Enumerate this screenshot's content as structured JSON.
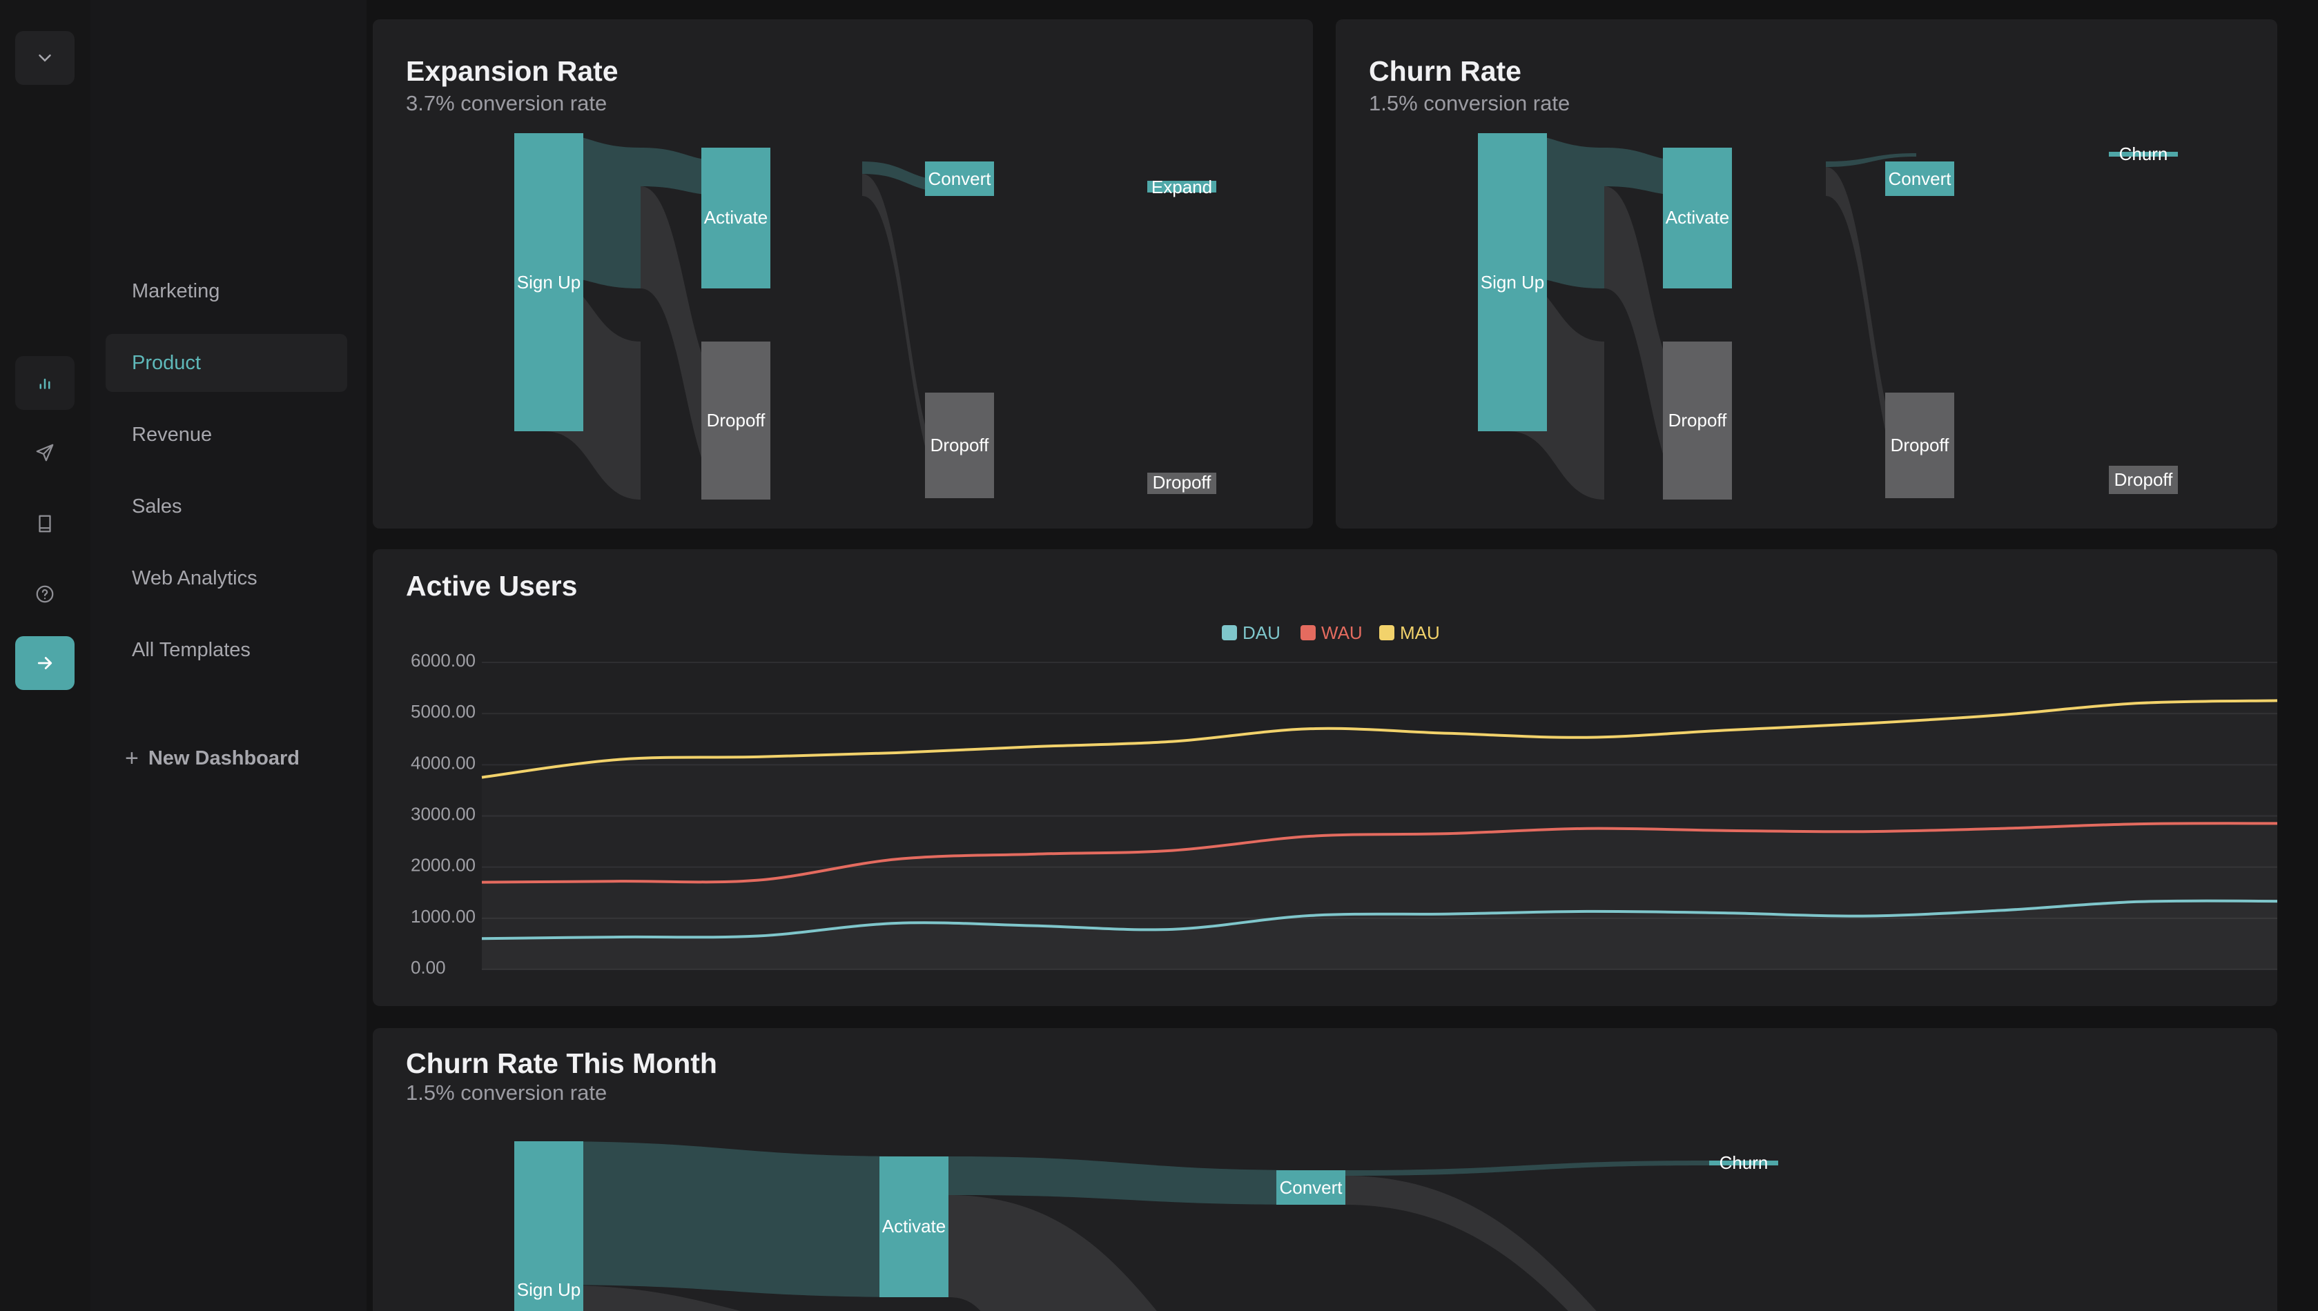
{
  "sidebar": {
    "items": [
      {
        "label": "Marketing"
      },
      {
        "label": "Product",
        "active": true
      },
      {
        "label": "Revenue"
      },
      {
        "label": "Sales"
      },
      {
        "label": "Web Analytics"
      },
      {
        "label": "All Templates"
      }
    ],
    "new_dashboard": "New Dashboard",
    "rail_icons": [
      "chevron-down-icon",
      "bar-chart-icon",
      "send-icon",
      "book-icon",
      "help-circle-icon",
      "arrow-right-icon"
    ]
  },
  "colors": {
    "accent": "#4fa7a8",
    "dropoff": "#606062",
    "dau": "#7fc6cb",
    "wau": "#e46b5f",
    "mau": "#f2d26b"
  },
  "cards": {
    "expansion": {
      "title": "Expansion Rate",
      "subtitle": "3.7% conversion rate",
      "nodes": {
        "signup": "Sign Up",
        "activate": "Activate",
        "dropoff1": "Dropoff",
        "convert": "Convert",
        "dropoff2": "Dropoff",
        "final": "Expand",
        "dropoff3": "Dropoff"
      }
    },
    "churn": {
      "title": "Churn Rate",
      "subtitle": "1.5% conversion rate",
      "nodes": {
        "signup": "Sign Up",
        "activate": "Activate",
        "dropoff1": "Dropoff",
        "convert": "Convert",
        "dropoff2": "Dropoff",
        "final": "Churn",
        "dropoff3": "Dropoff"
      }
    },
    "active_users": {
      "title": "Active Users"
    },
    "churn_month": {
      "title": "Churn Rate This Month",
      "subtitle": "1.5% conversion rate",
      "nodes": {
        "signup": "Sign Up",
        "activate": "Activate",
        "convert": "Convert",
        "final": "Churn"
      }
    }
  },
  "chart_data": {
    "type": "line",
    "title": "Active Users",
    "legend": "top-center",
    "grid": true,
    "ylim": [
      0,
      6000
    ],
    "yticks": [
      "0.00",
      "1000.00",
      "2000.00",
      "3000.00",
      "4000.00",
      "5000.00",
      "6000.00"
    ],
    "x": [
      0,
      1,
      2,
      3,
      4,
      5,
      6,
      7,
      8,
      9,
      10,
      11,
      12,
      13
    ],
    "series": [
      {
        "name": "DAU",
        "values": [
          550,
          580,
          600,
          850,
          800,
          730,
          1000,
          1030,
          1080,
          1050,
          990,
          1100,
          1270,
          1280
        ]
      },
      {
        "name": "WAU",
        "values": [
          1650,
          1670,
          1690,
          2100,
          2200,
          2270,
          2550,
          2600,
          2700,
          2660,
          2640,
          2700,
          2790,
          2800
        ]
      },
      {
        "name": "MAU",
        "values": [
          3700,
          4050,
          4100,
          4180,
          4300,
          4400,
          4650,
          4560,
          4480,
          4620,
          4750,
          4920,
          5150,
          5200
        ]
      }
    ]
  }
}
